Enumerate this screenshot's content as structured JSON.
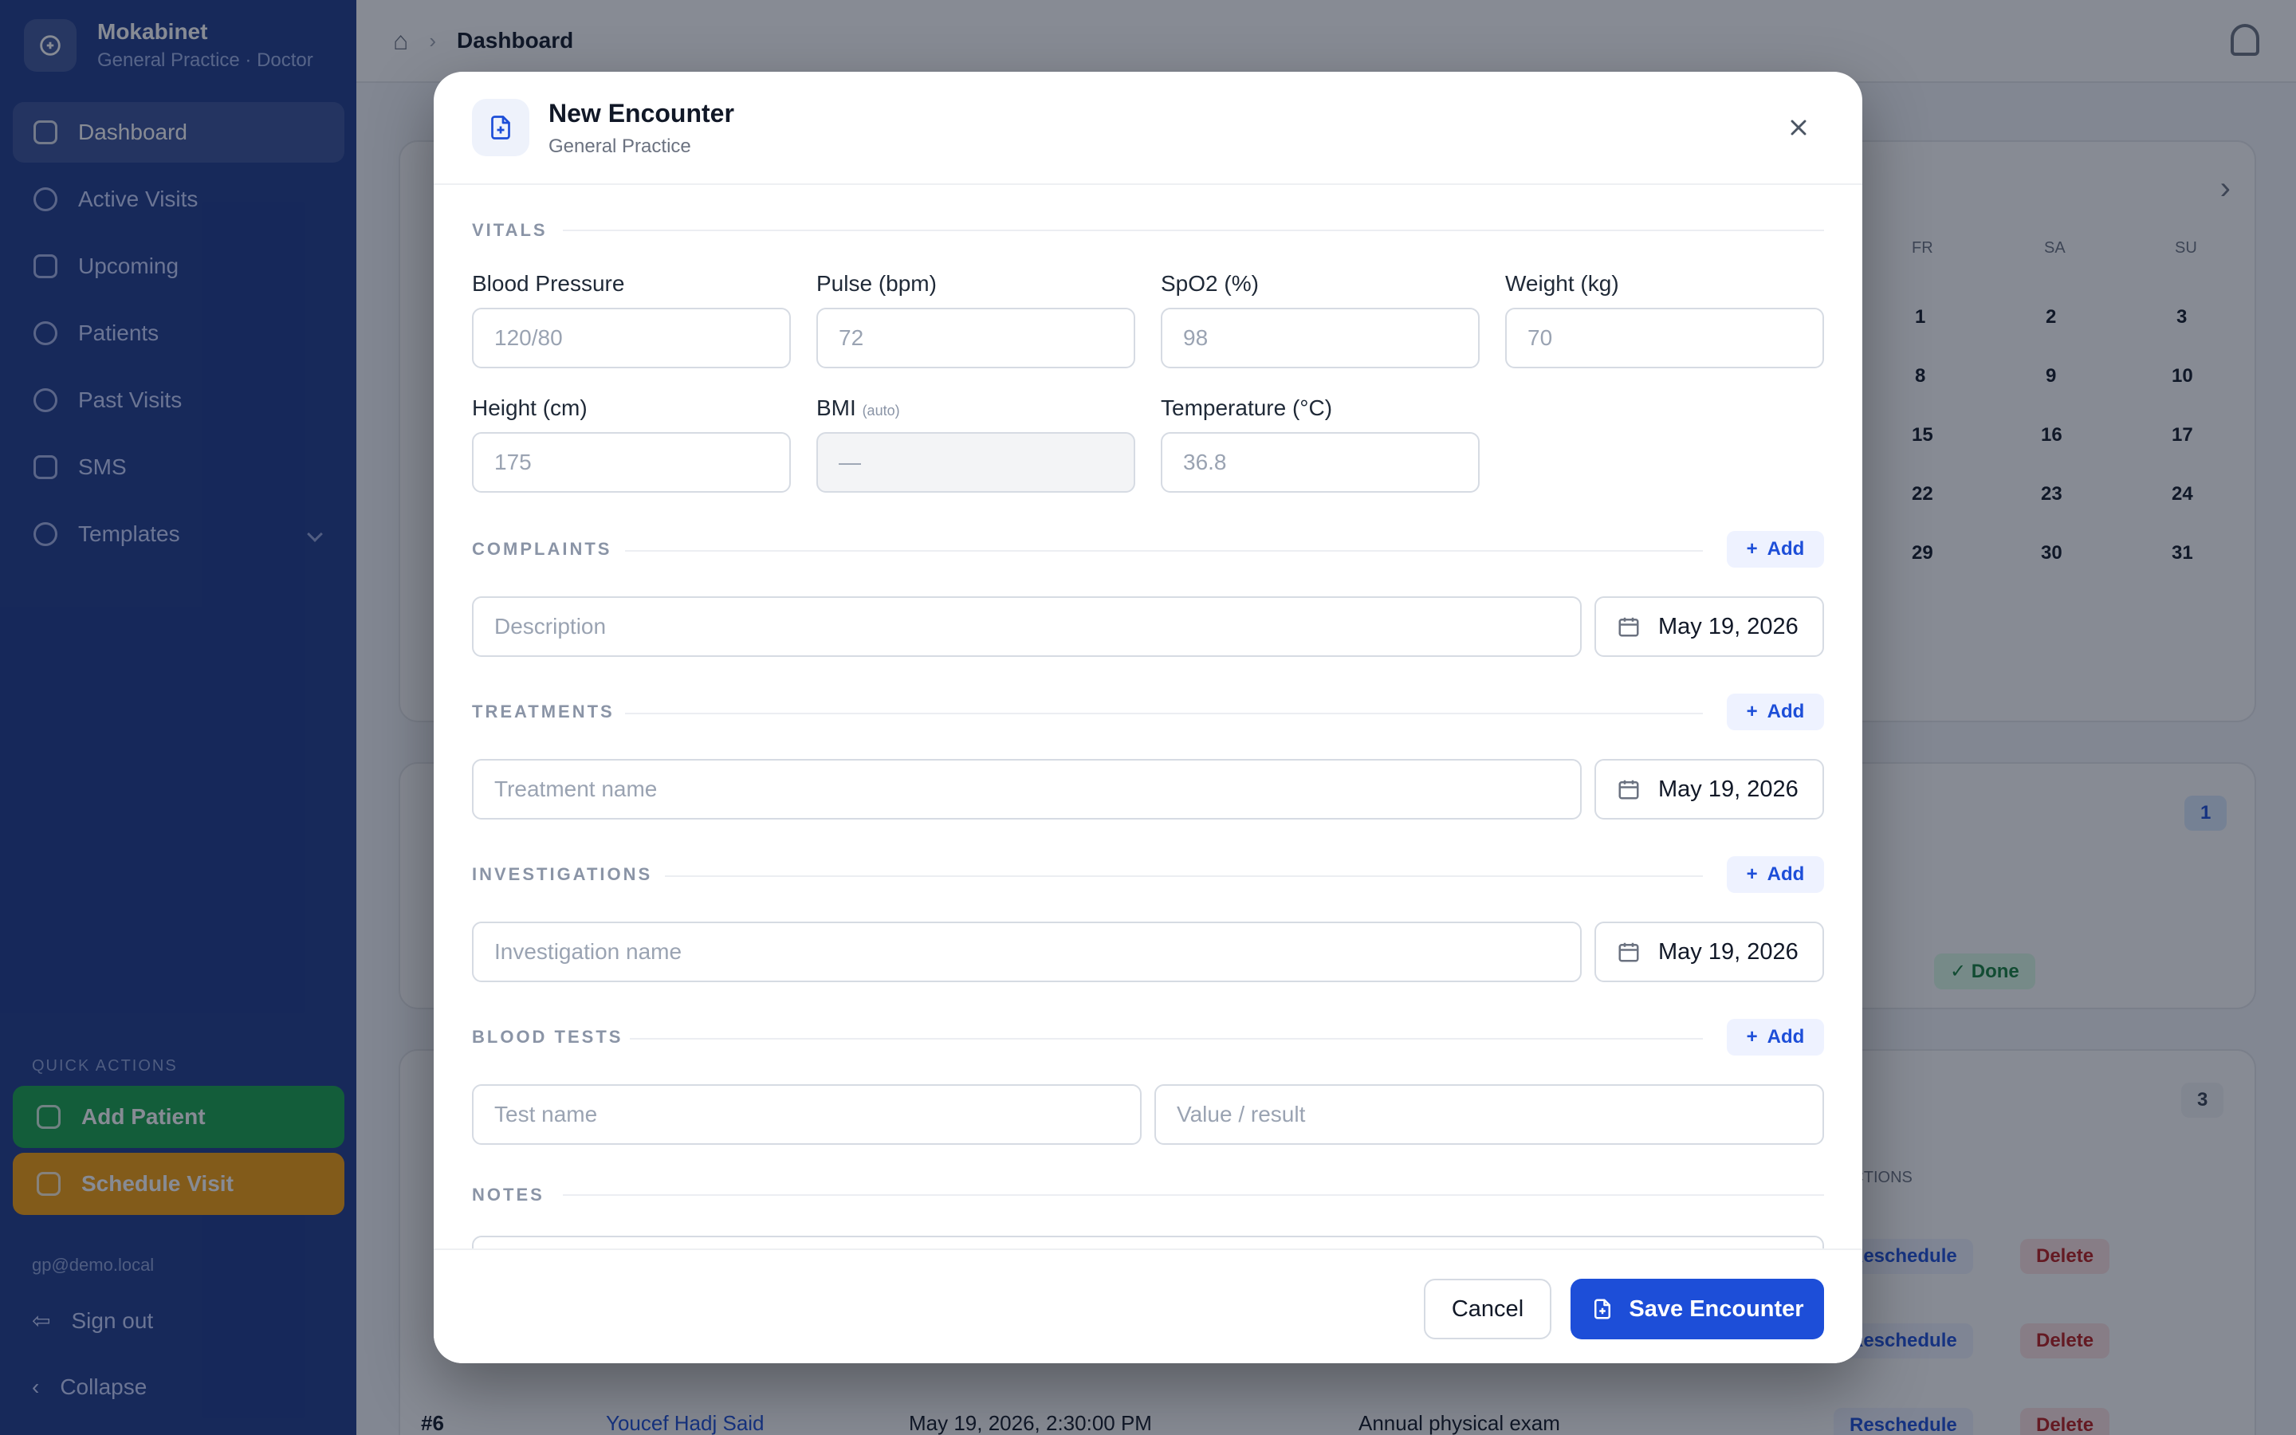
{
  "app": {
    "name": "Mokabinet",
    "subtitle": "General Practice · Doctor",
    "nav": [
      {
        "label": "Dashboard",
        "active": true
      },
      {
        "label": "Active Visits"
      },
      {
        "label": "Upcoming"
      },
      {
        "label": "Patients"
      },
      {
        "label": "Past Visits"
      },
      {
        "label": "SMS"
      },
      {
        "label": "Templates"
      }
    ],
    "quick_actions_label": "QUICK ACTIONS",
    "quick_actions": [
      "Add Patient",
      "Schedule Visit"
    ],
    "user_email": "gp@demo.local",
    "sign_out": "Sign out",
    "collapse": "Collapse",
    "breadcrumb": "Dashboard"
  },
  "background": {
    "weekdays": [
      "FR",
      "SA",
      "SU"
    ],
    "calendar_rows": [
      [
        "1",
        "2",
        "3"
      ],
      [
        "8",
        "9",
        "10"
      ],
      [
        "15",
        "16",
        "17"
      ],
      [
        "22",
        "23",
        "24"
      ],
      [
        "29",
        "30",
        "31"
      ]
    ],
    "badge_1": "1",
    "badge_2": "3",
    "status_done": "✓ Done",
    "actions_header": "ACTIONS",
    "reschedule": "Reschedule",
    "delete": "Delete",
    "row_id": "#6",
    "row_patient": "Youcef Hadj Said",
    "row_date": "May 19, 2026, 2:30:00 PM",
    "row_reason": "Annual physical exam"
  },
  "modal": {
    "title": "New Encounter",
    "subtitle": "General Practice",
    "vitals": {
      "section": "VITALS",
      "fields": [
        {
          "label": "Blood Pressure",
          "placeholder": "120/80"
        },
        {
          "label": "Pulse (bpm)",
          "placeholder": "72"
        },
        {
          "label": "SpO2 (%)",
          "placeholder": "98"
        },
        {
          "label": "Weight (kg)",
          "placeholder": "70"
        },
        {
          "label": "Height (cm)",
          "placeholder": "175"
        },
        {
          "label": "BMI",
          "hint": "(auto)",
          "placeholder": "—"
        },
        {
          "label": "Temperature (°C)",
          "placeholder": "36.8"
        }
      ]
    },
    "complaints": {
      "section": "COMPLAINTS",
      "add": "Add",
      "placeholder": "Description",
      "date": "May 19, 2026"
    },
    "treatments": {
      "section": "TREATMENTS",
      "add": "Add",
      "placeholder": "Treatment name",
      "date": "May 19, 2026"
    },
    "investigations": {
      "section": "INVESTIGATIONS",
      "add": "Add",
      "placeholder": "Investigation name",
      "date": "May 19, 2026"
    },
    "blood_tests": {
      "section": "BLOOD TESTS",
      "add": "Add",
      "name_placeholder": "Test name",
      "value_placeholder": "Value / result"
    },
    "notes": {
      "section": "NOTES"
    },
    "cancel": "Cancel",
    "save": "Save Encounter"
  }
}
